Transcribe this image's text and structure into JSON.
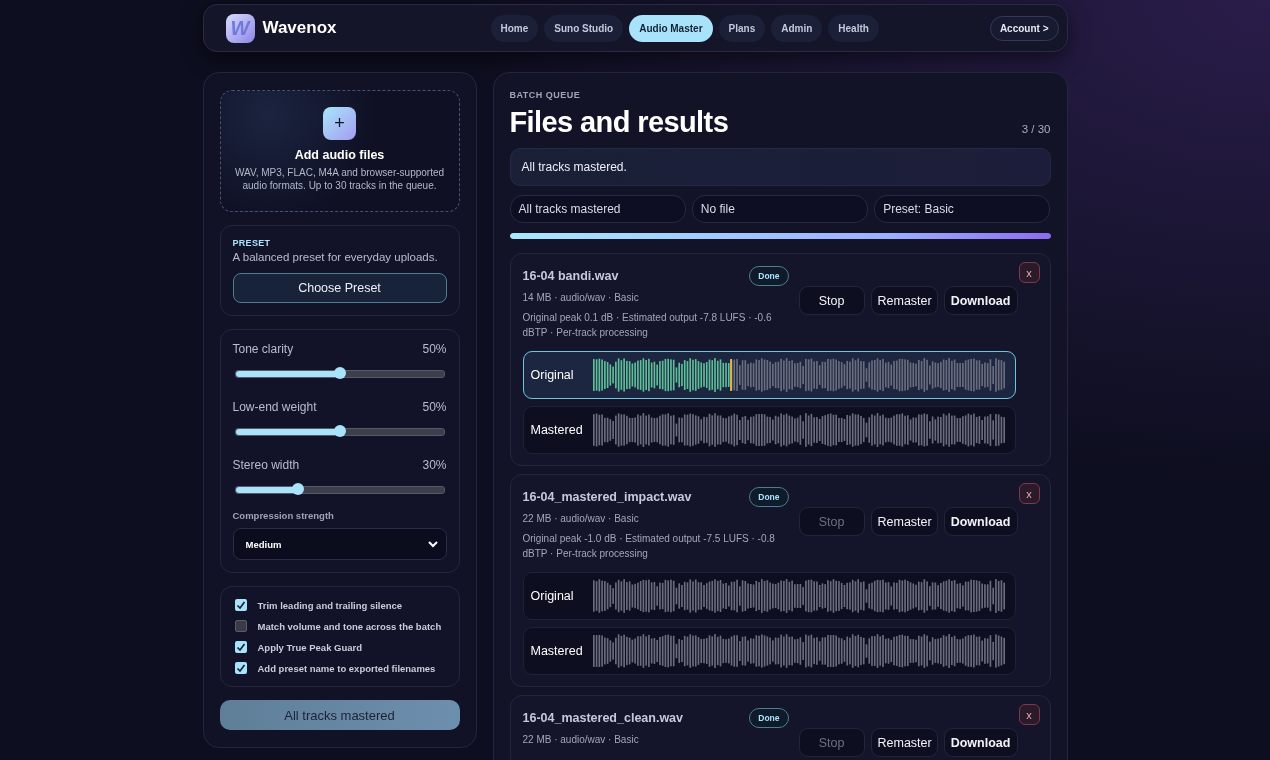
{
  "header": {
    "brand": "Wavenox",
    "logo": "W",
    "nav": [
      {
        "label": "Home",
        "selected": false
      },
      {
        "label": "Suno Studio",
        "selected": false
      },
      {
        "label": "Audio Master",
        "selected": true
      },
      {
        "label": "Plans",
        "selected": false
      },
      {
        "label": "Admin",
        "selected": false
      },
      {
        "label": "Health",
        "selected": false
      }
    ],
    "account": "Account >"
  },
  "upload": {
    "icon": "+",
    "title": "Add audio files",
    "description": "WAV, MP3, FLAC, M4A and browser-supported audio formats. Up to 30 tracks in the queue."
  },
  "preset": {
    "label": "PRESET",
    "description": "A balanced preset for everyday uploads.",
    "button": "Choose Preset"
  },
  "sliders": [
    {
      "label": "Tone clarity",
      "reading": "50%",
      "level": 0.5
    },
    {
      "label": "Low-end weight",
      "reading": "50%",
      "level": 0.5
    },
    {
      "label": "Stereo width",
      "reading": "30%",
      "level": 0.3
    }
  ],
  "compression": {
    "label": "Compression strength",
    "value": "Medium"
  },
  "options": [
    {
      "label": "Trim leading and trailing silence",
      "checked": true
    },
    {
      "label": "Match volume and tone across the batch",
      "checked": false
    },
    {
      "label": "Apply True Peak Guard",
      "checked": true
    },
    {
      "label": "Add preset name to exported filenames",
      "checked": true
    }
  ],
  "main_button": {
    "label": "All tracks mastered",
    "disabled": true
  },
  "queue": {
    "eyebrow": "BATCH QUEUE",
    "title": "Files and results",
    "count": "3 / 30",
    "status": "All tracks mastered.",
    "chips": [
      "All tracks mastered",
      "No file",
      "Preset: Basic"
    ],
    "level": 1
  },
  "tracks": [
    {
      "name": "16-04 bandi.wav",
      "badge": "Done",
      "meta": "14 MB · audio/wav · Basic",
      "details": "Original peak 0.1 dB · Estimated output -7.8 LUFS · -0.6 dBTP · Per-track processing",
      "buttons": [
        {
          "label": "Stop",
          "disabled": false
        },
        {
          "label": "Remaster",
          "disabled": false
        },
        {
          "label": "Download",
          "disabled": false
        }
      ],
      "close": "x",
      "waves": [
        {
          "label": "Original",
          "selected": true,
          "level": 0.34
        },
        {
          "label": "Mastered",
          "selected": false
        }
      ]
    },
    {
      "name": "16-04_mastered_impact.wav",
      "badge": "Done",
      "meta": "22 MB · audio/wav · Basic",
      "details": "Original peak -1.0 dB · Estimated output -7.5 LUFS · -0.8 dBTP · Per-track processing",
      "buttons": [
        {
          "label": "Stop",
          "disabled": true
        },
        {
          "label": "Remaster",
          "disabled": false
        },
        {
          "label": "Download",
          "disabled": false
        }
      ],
      "close": "x",
      "waves": [
        {
          "label": "Original",
          "selected": false
        },
        {
          "label": "Mastered",
          "selected": false
        }
      ]
    },
    {
      "name": "16-04_mastered_clean.wav",
      "badge": "Done",
      "meta": "22 MB · audio/wav · Basic",
      "buttons": [
        {
          "label": "Stop",
          "disabled": true
        },
        {
          "label": "Remaster",
          "disabled": false
        },
        {
          "label": "Download",
          "disabled": false
        }
      ],
      "close": "x"
    }
  ]
}
